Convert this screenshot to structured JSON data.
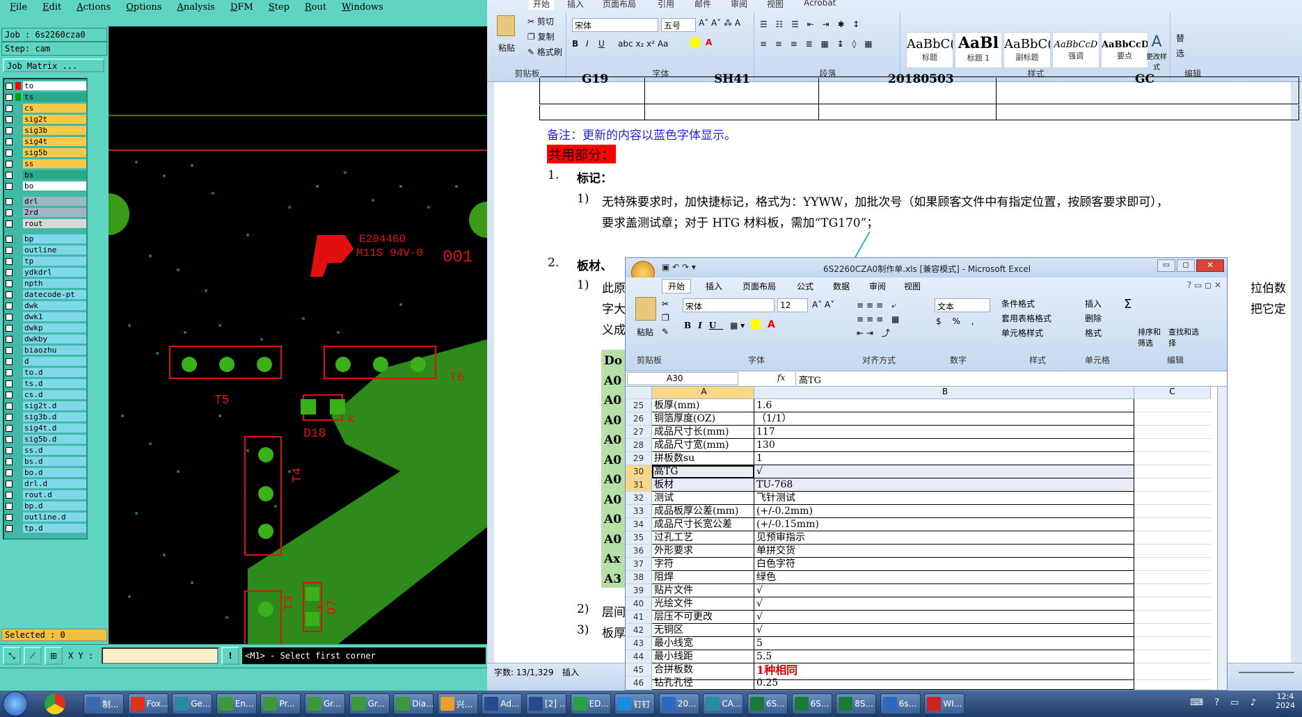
{
  "cam": {
    "menu": [
      "File",
      "Edit",
      "Actions",
      "Options",
      "Analysis",
      "DFM",
      "Step",
      "Rout",
      "Windows"
    ],
    "job": "Job : 6s2260cza0",
    "step": "Step: cam",
    "job_matrix": "Job Matrix ...",
    "selected": "Selected : 0",
    "xy_label": "X Y :",
    "xy_value": "",
    "status_message": "<M1> - Select first corner",
    "layers": [
      {
        "name": "to",
        "color": "#ffffff",
        "swatch": "#ff0000"
      },
      {
        "name": "ts",
        "color": "#2aa88a",
        "swatch": "#00a000"
      },
      {
        "name": "cs",
        "color": "#f7c94a",
        "swatch": ""
      },
      {
        "name": "sig2t",
        "color": "#f7c94a",
        "swatch": ""
      },
      {
        "name": "sig3b",
        "color": "#f7c94a",
        "swatch": ""
      },
      {
        "name": "sig4t",
        "color": "#f7c94a",
        "swatch": ""
      },
      {
        "name": "sig5b",
        "color": "#f7c94a",
        "swatch": ""
      },
      {
        "name": "ss",
        "color": "#f7c94a",
        "swatch": ""
      },
      {
        "name": "bs",
        "color": "#2aa88a",
        "swatch": ""
      },
      {
        "name": "bo",
        "color": "#ffffff",
        "swatch": ""
      },
      {
        "name": "drl",
        "color": "#9fb6c6",
        "swatch": ""
      },
      {
        "name": "2rd",
        "color": "#9fb6c6",
        "swatch": ""
      },
      {
        "name": "rout",
        "color": "#d8d8d8",
        "swatch": ""
      },
      {
        "name": "bp",
        "color": "#7fd8e8",
        "swatch": ""
      },
      {
        "name": "outline",
        "color": "#7fd8e8",
        "swatch": ""
      },
      {
        "name": "tp",
        "color": "#7fd8e8",
        "swatch": ""
      },
      {
        "name": "ydkdrl",
        "color": "#7fd8e8",
        "swatch": ""
      },
      {
        "name": "npth",
        "color": "#7fd8e8",
        "swatch": ""
      },
      {
        "name": "datecode-pt",
        "color": "#7fd8e8",
        "swatch": ""
      },
      {
        "name": "dwk",
        "color": "#7fd8e8",
        "swatch": ""
      },
      {
        "name": "dwk1",
        "color": "#7fd8e8",
        "swatch": ""
      },
      {
        "name": "dwkp",
        "color": "#7fd8e8",
        "swatch": ""
      },
      {
        "name": "dwkby",
        "color": "#7fd8e8",
        "swatch": ""
      },
      {
        "name": "biaozhu",
        "color": "#7fd8e8",
        "swatch": ""
      },
      {
        "name": "d",
        "color": "#7fd8e8",
        "swatch": ""
      },
      {
        "name": "to.d",
        "color": "#7fd8e8",
        "swatch": ""
      },
      {
        "name": "ts.d",
        "color": "#7fd8e8",
        "swatch": ""
      },
      {
        "name": "cs.d",
        "color": "#7fd8e8",
        "swatch": ""
      },
      {
        "name": "sig2t.d",
        "color": "#7fd8e8",
        "swatch": ""
      },
      {
        "name": "sig3b.d",
        "color": "#7fd8e8",
        "swatch": ""
      },
      {
        "name": "sig4t.d",
        "color": "#7fd8e8",
        "swatch": ""
      },
      {
        "name": "sig5b.d",
        "color": "#7fd8e8",
        "swatch": ""
      },
      {
        "name": "ss.d",
        "color": "#7fd8e8",
        "swatch": ""
      },
      {
        "name": "bs.d",
        "color": "#7fd8e8",
        "swatch": ""
      },
      {
        "name": "bo.d",
        "color": "#7fd8e8",
        "swatch": ""
      },
      {
        "name": "drl.d",
        "color": "#7fd8e8",
        "swatch": ""
      },
      {
        "name": "rout.d",
        "color": "#7fd8e8",
        "swatch": ""
      },
      {
        "name": "bp.d",
        "color": "#7fd8e8",
        "swatch": ""
      },
      {
        "name": "outline.d",
        "color": "#7fd8e8",
        "swatch": ""
      },
      {
        "name": "tp.d",
        "color": "#7fd8e8",
        "swatch": ""
      }
    ],
    "pcb_text": {
      "ul": "E204460",
      "ul2": "M11S 94V-0",
      "code": "001",
      "t5": "T5",
      "t6": "T6",
      "t4": "T4",
      "t3": "T3",
      "d18": "D18",
      "d7": "D7",
      "k1": "K",
      "k2": "K"
    }
  },
  "word": {
    "tabs": [
      "开始",
      "插入",
      "页面布局",
      "引用",
      "邮件",
      "审阅",
      "视图",
      "Acrobat"
    ],
    "clipboard": {
      "paste": "粘贴",
      "cut": "剪切",
      "copy": "复制",
      "format": "格式刷",
      "label": "剪贴板"
    },
    "font": {
      "name": "宋体",
      "size": "五号",
      "label": "字体"
    },
    "para_label": "段落",
    "styles": [
      {
        "preview": "AaBbC(",
        "name": "标题"
      },
      {
        "preview": "AaBl",
        "name": "标题 1"
      },
      {
        "preview": "AaBbC(",
        "name": "副标题"
      },
      {
        "preview": "AaBbCcD",
        "name": "强调"
      },
      {
        "preview": "AaBbCcD",
        "name": "要点"
      }
    ],
    "change_styles": "更改样式",
    "styles_label": "样式",
    "edit_label": "编辑",
    "edit_items": [
      "替",
      "选"
    ],
    "table_row": [
      "G19",
      "SH41",
      "20180503",
      "GC"
    ],
    "note": "备注：更新的内容以蓝色字体显示。",
    "section_common": "共用部分：",
    "h1_num": "1.",
    "h1": "标记：",
    "p1_num": "1)",
    "p1_line1": "无特殊要求时，加快捷标记，格式为：YYWW，加批次号（如果顾客文件中有指定位置，按顾客要求即可），",
    "p1_line2": "要求盖测试章；对于 HTG 材料板，需加“TG170”；",
    "h2_num": "2.",
    "h2": "板材、",
    "p2_num": "1)",
    "p2_text": "此原",
    "p2_line2": "字大",
    "p2_line3": "义成",
    "p2_right1": "拉伯数",
    "p2_right2": "把它定",
    "green_items": [
      "Do",
      "A0",
      "A0",
      "A0",
      "A0",
      "A0",
      "A0",
      "A0",
      "A0",
      "A0",
      "Ax",
      "A3"
    ],
    "p3_num": "2)",
    "p3_text": "层间",
    "p4_num": "3)",
    "p4_text": "板厚",
    "status_words": "字数: 13/1,329",
    "status_insert": "插入"
  },
  "excel": {
    "title": "6S2260CZA0制作单.xls  [兼容模式] - Microsoft Excel",
    "tabs": [
      "开始",
      "插入",
      "页面布局",
      "公式",
      "数据",
      "审阅",
      "视图"
    ],
    "font_name": "宋体",
    "font_size": "12",
    "number_format": "文本",
    "groups": [
      "剪贴板",
      "字体",
      "对齐方式",
      "数字",
      "样式",
      "单元格",
      "编辑"
    ],
    "styles_btns": [
      "条件格式",
      "套用表格格式",
      "单元格样式"
    ],
    "cells_btns": [
      "插入",
      "删除",
      "格式"
    ],
    "edit_btns": [
      "排序和筛选",
      "查找和选择"
    ],
    "paste": "粘贴",
    "name_box": "A30",
    "fx": "fx",
    "formula_value": "高TG",
    "col_headers": [
      "A",
      "B",
      "C"
    ],
    "rows": [
      {
        "n": "25",
        "a": "板厚(mm)",
        "b": "1.6"
      },
      {
        "n": "26",
        "a": "铜箔厚度(OZ)",
        "b": "（1/1）"
      },
      {
        "n": "27",
        "a": "成品尺寸长(mm)",
        "b": "117"
      },
      {
        "n": "28",
        "a": "成品尺寸宽(mm)",
        "b": "130"
      },
      {
        "n": "29",
        "a": "拼板数su",
        "b": "1"
      },
      {
        "n": "30",
        "a": "高TG",
        "b": "√"
      },
      {
        "n": "31",
        "a": "板材",
        "b": "TU-768"
      },
      {
        "n": "32",
        "a": "测试",
        "b": "飞针测试"
      },
      {
        "n": "33",
        "a": "成品板厚公差(mm)",
        "b": "(+/-0.2mm)"
      },
      {
        "n": "34",
        "a": "成品尺寸长宽公差",
        "b": "(+/-0.15mm)"
      },
      {
        "n": "35",
        "a": "过孔工艺",
        "b": "见预审指示"
      },
      {
        "n": "36",
        "a": "外形要求",
        "b": "单拼交货"
      },
      {
        "n": "37",
        "a": "字符",
        "b": "白色字符"
      },
      {
        "n": "38",
        "a": "阻焊",
        "b": "绿色"
      },
      {
        "n": "39",
        "a": "贴片文件",
        "b": "√"
      },
      {
        "n": "40",
        "a": "光绘文件",
        "b": "√"
      },
      {
        "n": "41",
        "a": "层压不可更改",
        "b": "√"
      },
      {
        "n": "42",
        "a": "无铜区",
        "b": "√"
      },
      {
        "n": "43",
        "a": "最小线宽",
        "b": "5"
      },
      {
        "n": "44",
        "a": "最小线距",
        "b": "5.5"
      },
      {
        "n": "45",
        "a": "合拼板数",
        "b": "1种相同"
      },
      {
        "n": "46",
        "a": "钻孔孔径",
        "b": "0.25"
      }
    ]
  },
  "taskbar": {
    "items": [
      "制...",
      "Fox...",
      "Ge...",
      "En...",
      "Pr...",
      "Gr...",
      "Gr...",
      "Dia...",
      "兴...",
      "Ad...",
      "[2] ...",
      "ED...",
      "钉钉",
      "20...",
      "CA...",
      "6S...",
      "6S...",
      "8S...",
      "6s...",
      "WI..."
    ],
    "clock": "12:4",
    "date": "2024"
  }
}
